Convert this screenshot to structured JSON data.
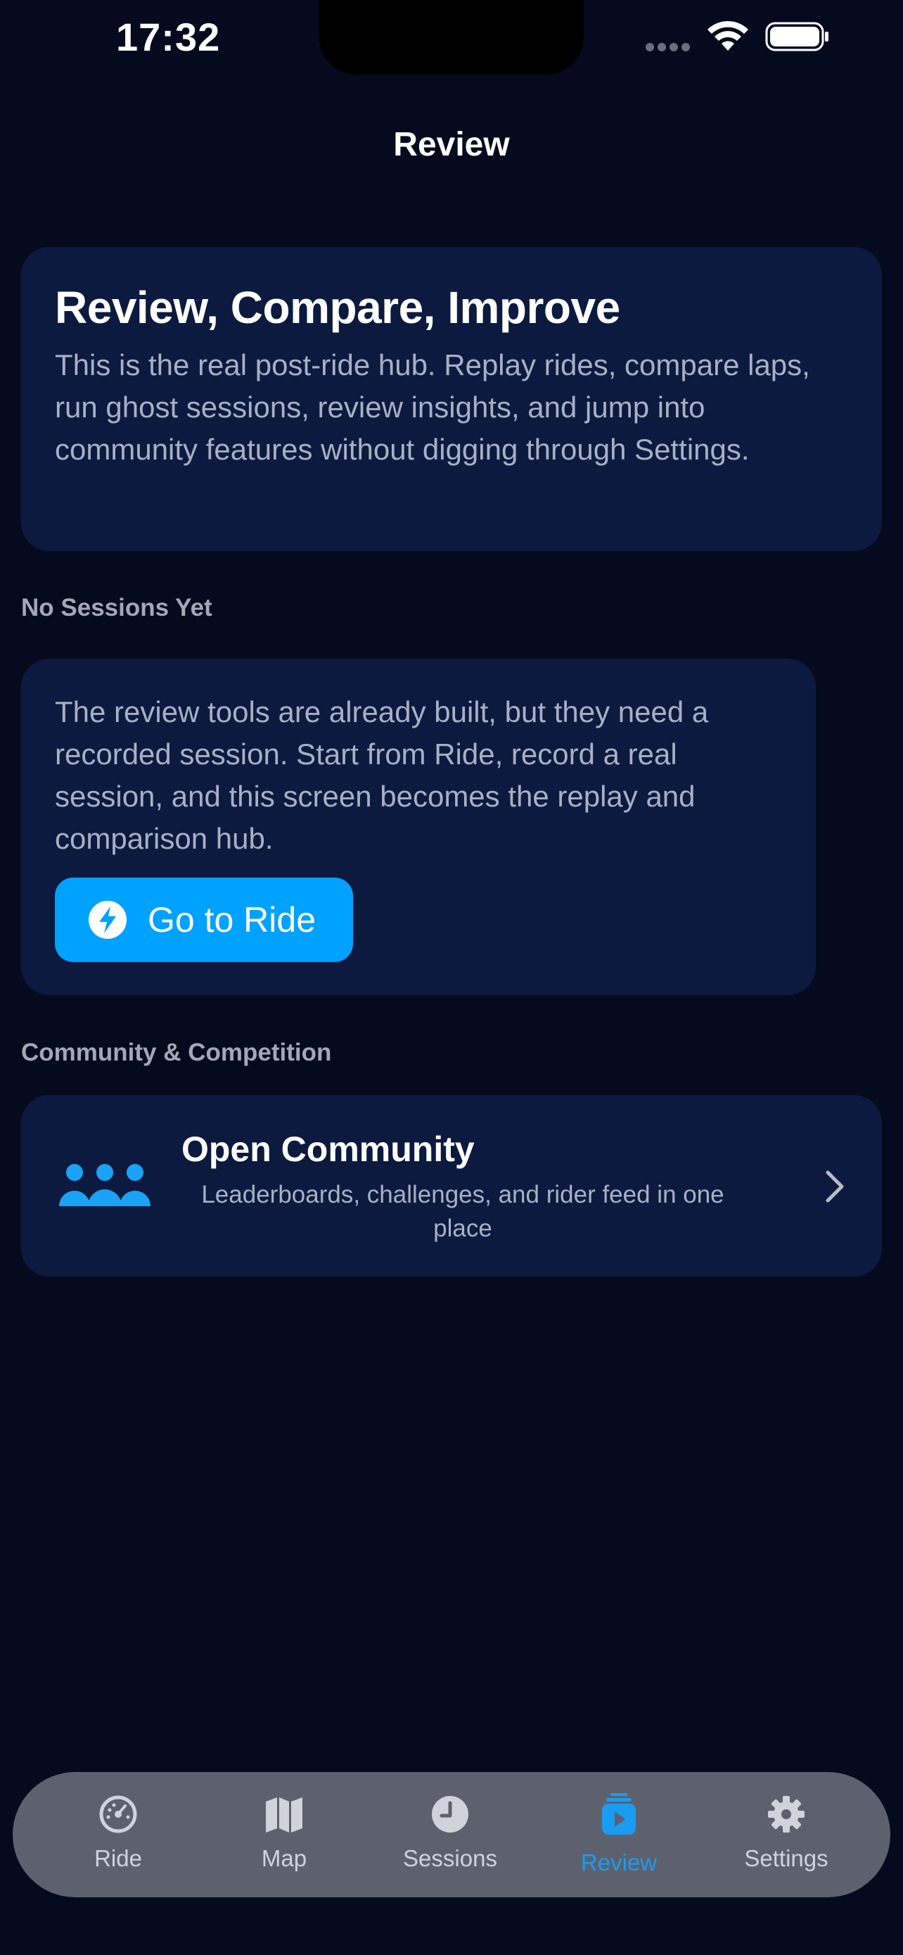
{
  "status_bar": {
    "time": "17:32"
  },
  "nav": {
    "title": "Review"
  },
  "hero": {
    "title": "Review, Compare, Improve",
    "body": "This is the real post-ride hub. Replay rides, compare laps, run ghost sessions, review insights, and jump into community features without digging through Settings."
  },
  "sessions_section": {
    "label": "No Sessions Yet",
    "body": "The review tools are already built, but they need a recorded session. Start from Ride, record a real session, and this screen becomes the replay and comparison hub.",
    "button_label": "Go to Ride",
    "button_icon": "bolt-icon"
  },
  "community_section": {
    "label": "Community & Competition",
    "title": "Open Community",
    "subtitle": "Leaderboards, challenges, and rider feed in one place",
    "icon": "people-icon"
  },
  "tab_bar": {
    "tabs": [
      {
        "label": "Ride",
        "icon": "speedometer-icon",
        "active": false
      },
      {
        "label": "Map",
        "icon": "map-icon",
        "active": false
      },
      {
        "label": "Sessions",
        "icon": "clock-icon",
        "active": false
      },
      {
        "label": "Review",
        "icon": "play-stack-icon",
        "active": true
      },
      {
        "label": "Settings",
        "icon": "gear-icon",
        "active": false
      }
    ]
  },
  "colors": {
    "background": "#050a1e",
    "card": "#0c1a3f",
    "accent": "#00a2ff",
    "tab_bar": "#5d616d",
    "active_tab": "#1a9cf2"
  }
}
